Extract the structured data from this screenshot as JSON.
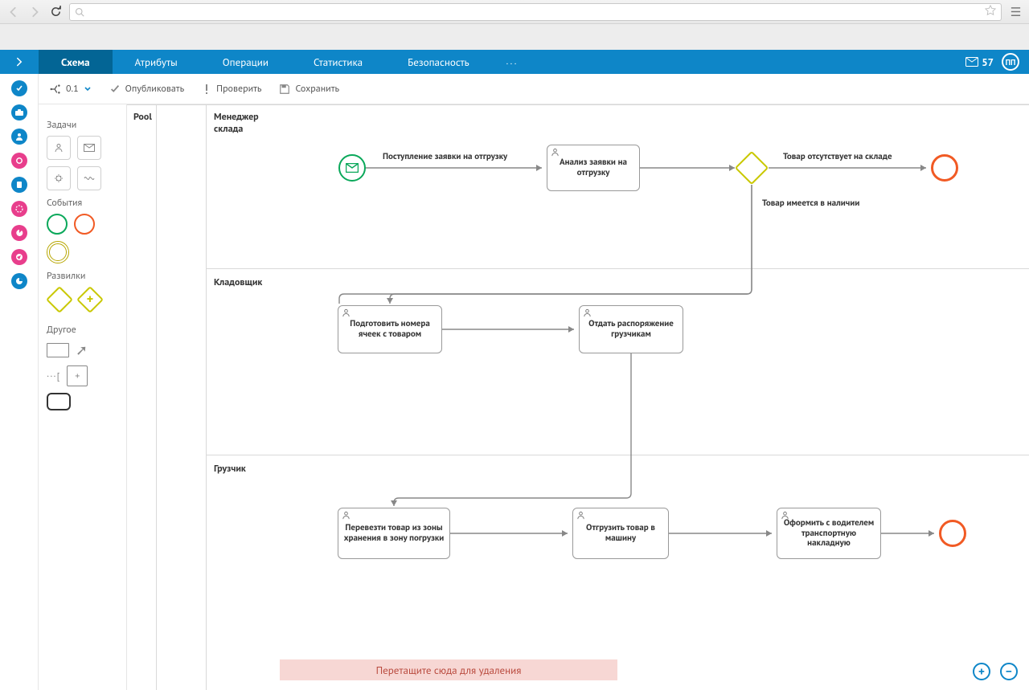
{
  "browser": {
    "url": ""
  },
  "header": {
    "tabs": [
      "Схема",
      "Атрибуты",
      "Операции",
      "Статистика",
      "Безопасность"
    ],
    "more": "...",
    "mail_count": "57",
    "avatar_initials": "ПП"
  },
  "toolbar": {
    "version": "0.1",
    "publish": "Опубликовать",
    "validate": "Проверить",
    "save": "Сохранить"
  },
  "palette": {
    "tasks_head": "Задачи",
    "events_head": "События",
    "gateways_head": "Развилки",
    "other_head": "Другое"
  },
  "diagram": {
    "pool_title": "Pool",
    "lanes": [
      "Менеджер\nсклада",
      "Кладовщик",
      "Грузчик"
    ],
    "tasks": {
      "t1": "Анализ заявки на отгрузку",
      "t2": "Подготовить номера ячеек с товаром",
      "t3": "Отдать распоряжение грузчикам",
      "t4": "Перевезти товар из зоны хранения в зону погрузки",
      "t5": "Отгрузить товар в машину",
      "t6": "Оформить с водителем транспортную накладную"
    },
    "edge_labels": {
      "e1": "Поступление заявки на отгрузку",
      "e2": "Товар отсутствует на складе",
      "e3": "Товар имеется в наличии"
    }
  },
  "delete_zone": "Перетащите сюда для удаления"
}
